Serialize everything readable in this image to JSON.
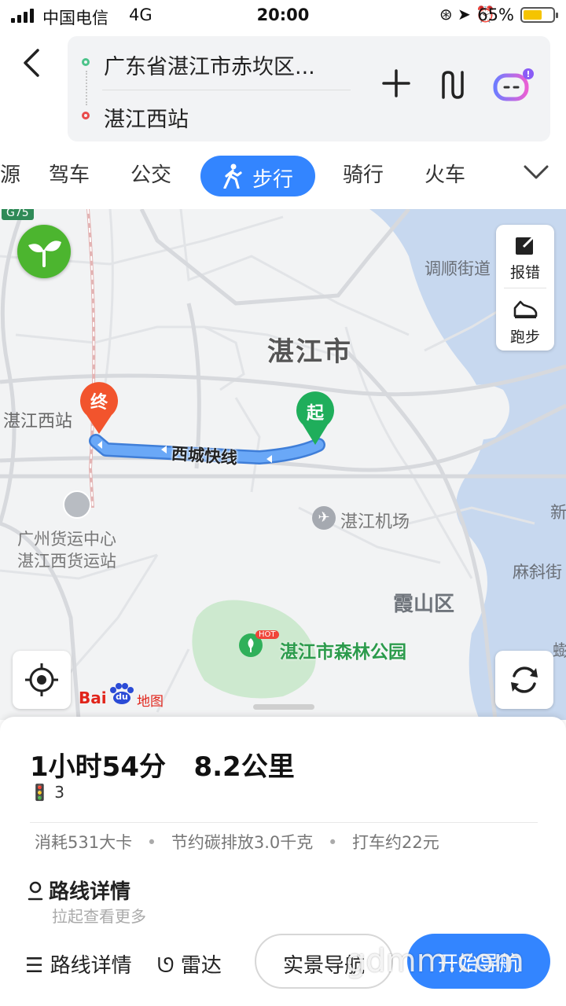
{
  "status_bar": {
    "carrier": "中国电信",
    "network": "4G",
    "time": "20:00",
    "battery": "65%",
    "battery_level": 0.65
  },
  "header": {
    "start": "广东省湛江市赤坎区...",
    "end": "湛江西站"
  },
  "tabs": [
    {
      "label": "源"
    },
    {
      "label": "驾车"
    },
    {
      "label": "公交"
    },
    {
      "label": "步行",
      "active": true
    },
    {
      "label": "骑行"
    },
    {
      "label": "火车"
    }
  ],
  "map": {
    "road_badge": "G75",
    "city": "湛江市",
    "district": "霞山区",
    "labels": {
      "tiaoshun": "调顺街道",
      "west_station": "湛江西站",
      "freight_1": "广州货运中心",
      "freight_2": "湛江西货运站",
      "airport": "湛江机场",
      "forest_park": "湛江市森林公园",
      "hot": "HOT",
      "maxie": "麻斜街",
      "xin": "新",
      "qiao": "蟛"
    },
    "route_name": "西城快线",
    "start_marker": "起",
    "end_marker": "终",
    "report_label": "报错",
    "run_label": "跑步",
    "logo_text": "Bai",
    "logo_du": "du",
    "logo_map": "地图"
  },
  "summary": {
    "duration_distance": "1小时54分   8.2公里",
    "traffic_lights": "3",
    "calories": "消耗531大卡",
    "carbon": "节约碳排放3.0千克",
    "taxi": "打车约22元",
    "detail_title": "路线详情",
    "detail_sub": "拉起查看更多"
  },
  "bottom_bar": {
    "detail": "路线详情",
    "radar": "雷达",
    "ar_nav": "实景导航",
    "start_nav": "开始导航"
  },
  "watermark": "gdmm.com",
  "colors": {
    "accent": "#3385ff",
    "route": "#5b9df5",
    "start_green": "#1fae5b",
    "end_orange": "#f2542d"
  }
}
